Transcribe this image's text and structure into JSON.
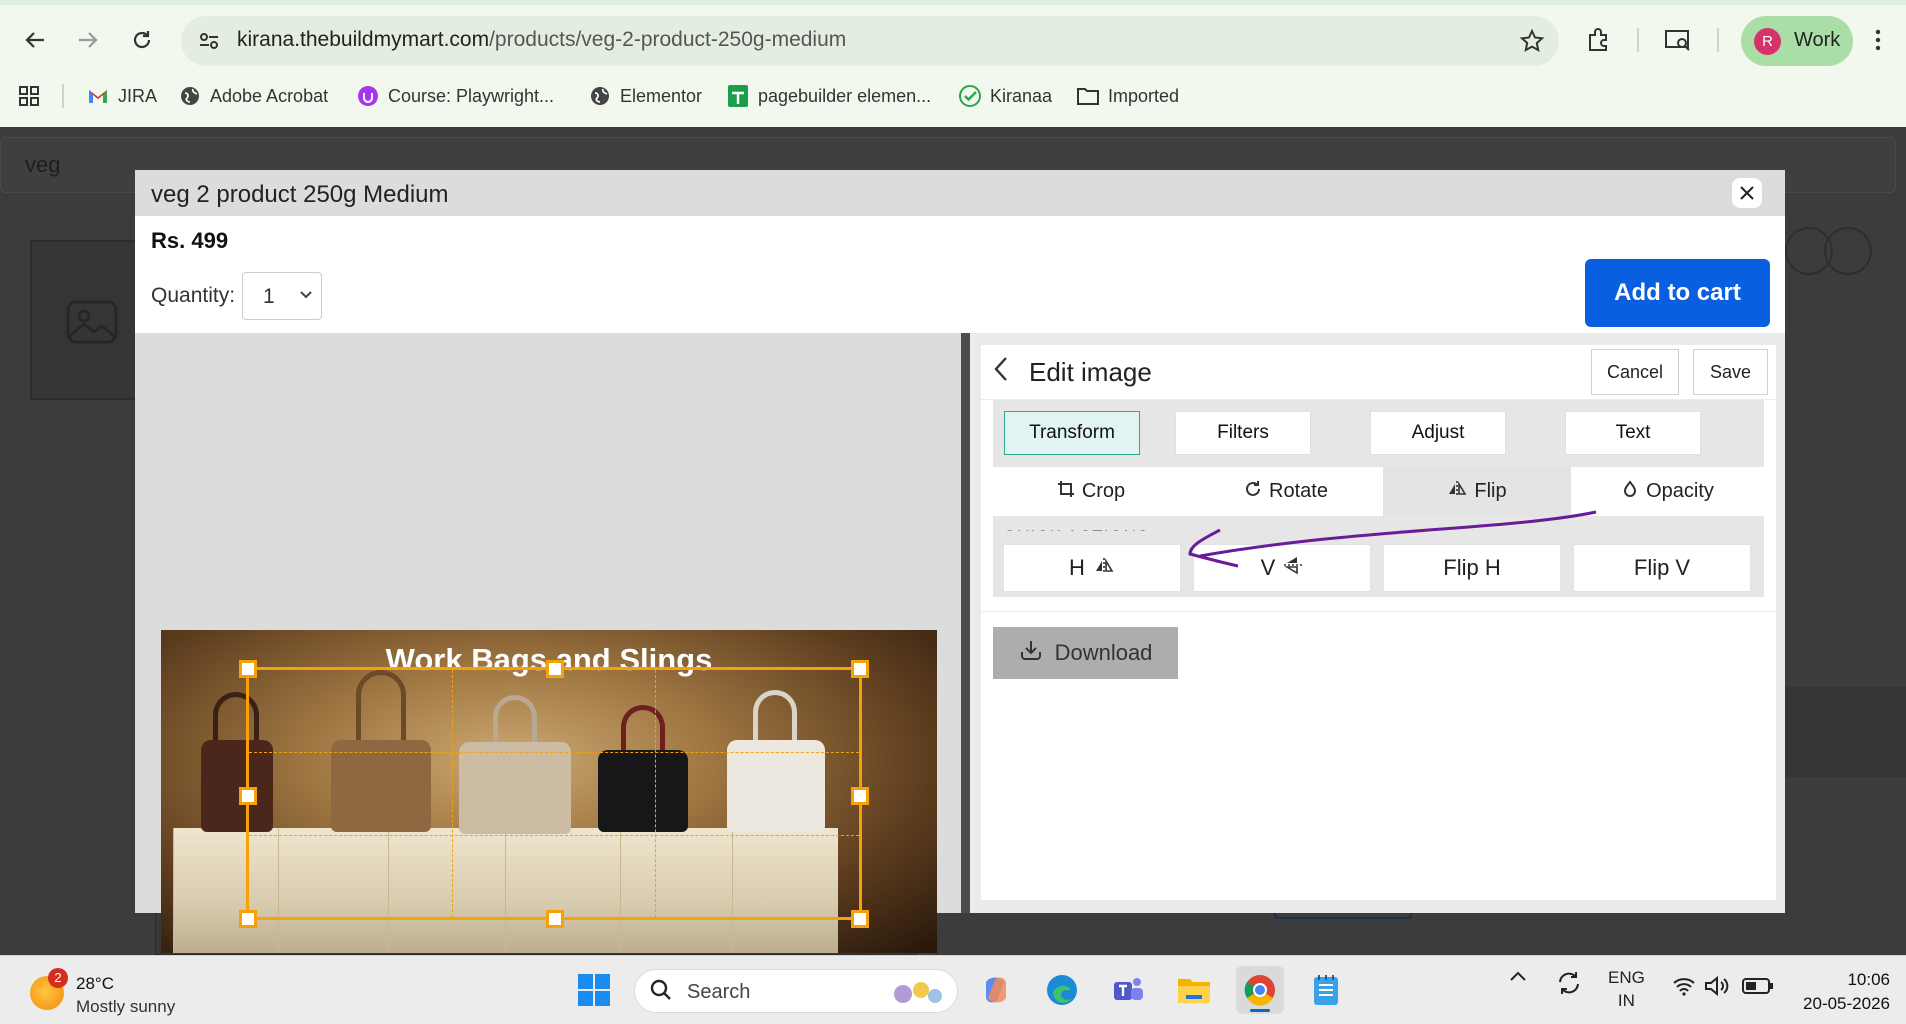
{
  "browser": {
    "url_host": "kirana.thebuildmymart.com",
    "url_path": "/products/veg-2-product-250g-medium",
    "profile_initial": "R",
    "profile_label": "Work",
    "bookmarks": [
      {
        "label": "JIRA",
        "icon": "gmail-icon"
      },
      {
        "label": "Adobe Acrobat",
        "icon": "globe-icon"
      },
      {
        "label": "Course: Playwright...",
        "icon": "udemy-icon"
      },
      {
        "label": "Elementor",
        "icon": "globe-icon"
      },
      {
        "label": "pagebuilder elemen...",
        "icon": "sheets-icon"
      },
      {
        "label": "Kiranaa",
        "icon": "check-icon"
      },
      {
        "label": "Imported",
        "icon": "folder-icon"
      }
    ]
  },
  "page": {
    "search_value": "veg"
  },
  "modal": {
    "title": "veg 2 product 250g Medium",
    "price": "Rs. 499",
    "quantity_label": "Quantity:",
    "quantity_value": "1",
    "add_to_cart": "Add to cart",
    "image_title": "Work Bags and Slings"
  },
  "editor": {
    "title": "Edit image",
    "cancel": "Cancel",
    "save": "Save",
    "tabs": [
      "Transform",
      "Filters",
      "Adjust",
      "Text"
    ],
    "active_tab": "Transform",
    "subtabs": [
      {
        "label": "Crop",
        "icon": "crop-icon"
      },
      {
        "label": "Rotate",
        "icon": "rotate-icon"
      },
      {
        "label": "Flip",
        "icon": "flip-icon"
      },
      {
        "label": "Opacity",
        "icon": "opacity-icon"
      }
    ],
    "active_subtab": "Flip",
    "quick_actions_label": "QUICK ACTIONS",
    "quick_actions": [
      "H",
      "V",
      "Flip H",
      "Flip V"
    ],
    "download": "Download"
  },
  "taskbar": {
    "weather_badge": "2",
    "temperature": "28°C",
    "weather": "Mostly sunny",
    "search_label": "Search",
    "lang_top": "ENG",
    "lang_bottom": "IN",
    "time": "10:06",
    "date": "20-05-2026"
  },
  "colors": {
    "accent_blue": "#0a5fe0",
    "crop_orange": "#f5a20a",
    "annotation_purple": "#6a1b9a",
    "tab_active_teal": "#2aa893"
  }
}
